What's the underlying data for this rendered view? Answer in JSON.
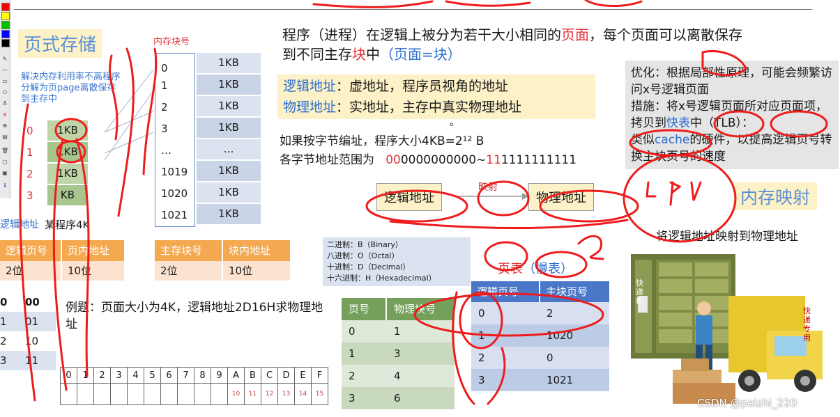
{
  "toolbar": {
    "swatches": [
      "#ff0000",
      "#ffff00",
      "#00c000",
      "#0000ff",
      "#000000"
    ],
    "glyphs": [
      "✎",
      "—",
      "▭",
      "⬭",
      "A",
      "×",
      "⊕",
      "▤",
      "🗑",
      "▢",
      "▣",
      "ℹ"
    ]
  },
  "paging": {
    "title": "页式存储",
    "desc": "解决内存利用率不高程序分解为页page离散保存到主存中",
    "mem_block_label": "内存块号",
    "pages": [
      {
        "num": "0",
        "size": "1KB"
      },
      {
        "num": "1",
        "size": "1KB"
      },
      {
        "num": "2",
        "size": "1KB"
      },
      {
        "num": "3",
        "size": "KB"
      }
    ],
    "program_label": "某程序4K",
    "logic_label": "逻辑地址",
    "logic_cols": [
      "逻辑页号",
      "页内地址"
    ],
    "logic_vals": [
      "2位",
      "10位"
    ],
    "bits_table": [
      [
        "0",
        "00"
      ],
      [
        "1",
        "01"
      ],
      [
        "2",
        "10"
      ],
      [
        "3",
        "11"
      ]
    ],
    "mem_blocks": [
      {
        "num": "0",
        "size": "1KB"
      },
      {
        "num": "1",
        "size": "1KB"
      },
      {
        "num": "2",
        "size": "1KB"
      },
      {
        "num": "3",
        "size": "1KB"
      },
      {
        "num": "…",
        "size": "…"
      },
      {
        "num": "1019",
        "size": "1KB"
      },
      {
        "num": "1020",
        "size": "1KB"
      },
      {
        "num": "1021",
        "size": "1KB"
      }
    ],
    "main_cols": [
      "主存块号",
      "块内地址"
    ],
    "main_vals": [
      "2位",
      "10位"
    ]
  },
  "example": {
    "text": "例题：页面大小为4K，逻辑地址2D16H求物理地址",
    "hex_header": [
      "0",
      "1",
      "2",
      "3",
      "4",
      "5",
      "6",
      "7",
      "8",
      "9",
      "A",
      "B",
      "C",
      "D",
      "E",
      "F"
    ],
    "hex_second": [
      "",
      "",
      "",
      "",
      "",
      "",
      "",
      "",
      "",
      "",
      "10",
      "11",
      "12",
      "13",
      "14",
      "15"
    ]
  },
  "center": {
    "headline_a": "程序（进程）在逻辑上被分为若干大小相同的",
    "headline_page": "页面",
    "headline_b": "，每个页面可以离散保存",
    "headline_c": "到不同主存",
    "headline_block": "块",
    "headline_d": "中",
    "headline_eq": "（页面=块）",
    "logic_def_term": "逻辑地址",
    "logic_def": "：虚地址，程序员视角的地址",
    "phys_def_term": "物理地址",
    "phys_def": "：实地址，主存中真实物理地址",
    "byte_addr": "如果按字节编址，程序大小4KB=2¹² B",
    "range_a": "各字节地址范围为",
    "range_hi1": "00",
    "range_lo1": "0000000000~",
    "range_hi2": "11",
    "range_lo2": "1111111111",
    "dot": "。",
    "map_from": "逻辑地址",
    "map_label": "映射",
    "map_to": "物理地址",
    "bases": [
      "二进制：B（Binary）",
      "八进制：O（Octal）",
      "十进制：D（Decimal）",
      "十六进制：H（Hexadecimal）"
    ],
    "page_table_cols": [
      "页号",
      "物理块号"
    ],
    "page_table": [
      [
        "0",
        "1"
      ],
      [
        "1",
        "3"
      ],
      [
        "2",
        "4"
      ],
      [
        "3",
        "6"
      ]
    ],
    "ptable_title_a": "页表",
    "ptable_title_b": "（慢表）",
    "ptable_cols": [
      "逻辑页号",
      "主块页号"
    ],
    "ptable_rows": [
      [
        "0",
        "2"
      ],
      [
        "1",
        "1020"
      ],
      [
        "2",
        "0"
      ],
      [
        "3",
        "1021"
      ]
    ]
  },
  "right": {
    "note_1": "优化：根据局部性原理，可能会频繁访问x号逻辑页面",
    "note_2a": "措施：将x号逻辑页面所对应页面项，拷贝到",
    "note_2_fast": "快表",
    "note_2b": "中（TLB）：",
    "note_3a": "类似",
    "note_cache": "cache",
    "note_3b": "的硬件，以提高逻辑页号转换主块页号的速度",
    "mapping_title": "内存映射",
    "mapping_desc": "将逻辑地址映射到物理地址",
    "handwrite": "CPU",
    "locker_label": "快递柜",
    "truck_label": "快递专用",
    "watermark": "CSDN @peizhi_220"
  }
}
